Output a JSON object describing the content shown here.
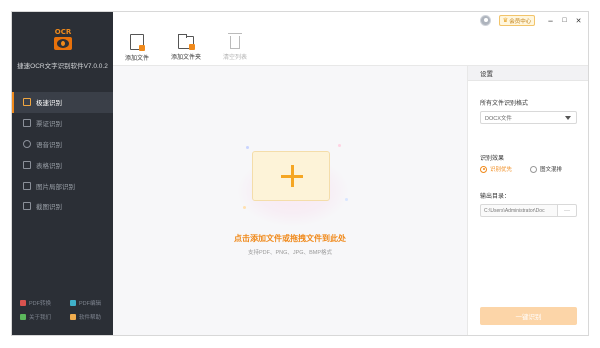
{
  "app": {
    "logo_text": "OCR",
    "title": "捷速OCR文字识别软件V7.0.0.2"
  },
  "sidebar": {
    "items": [
      {
        "label": "极速识别",
        "icon": "lightning-icon",
        "active": true
      },
      {
        "label": "票证识别",
        "icon": "ticket-icon",
        "active": false
      },
      {
        "label": "语音识别",
        "icon": "microphone-icon",
        "active": false
      },
      {
        "label": "表格识别",
        "icon": "table-icon",
        "active": false
      },
      {
        "label": "图片局部识别",
        "icon": "crop-icon",
        "active": false
      },
      {
        "label": "截图识别",
        "icon": "screenshot-icon",
        "active": false
      }
    ],
    "bottom_links": [
      {
        "label": "PDF转换",
        "color": "#d9534f"
      },
      {
        "label": "PDF编辑",
        "color": "#3fb0c9"
      },
      {
        "label": "关于我们",
        "color": "#5cb85c"
      },
      {
        "label": "软件帮助",
        "color": "#f0ad4e"
      }
    ]
  },
  "titlebar": {
    "vip_label": "会员中心",
    "minimize": "−",
    "maximize": "□",
    "close": "✕"
  },
  "toolbar": {
    "add_file": "添加文件",
    "add_folder": "添加文件夹",
    "clear_list": "清空列表"
  },
  "dropzone": {
    "main_text": "点击添加文件或拖拽文件到此处",
    "sub_text": "支持PDF、PNG、JPG、BMP格式"
  },
  "settings": {
    "header": "设置",
    "format_label": "所有文件识别格式",
    "format_value": "DOCX文件",
    "effect_label": "识别效果",
    "effect_options": [
      {
        "label": "识别优先",
        "checked": true
      },
      {
        "label": "图文混排",
        "checked": false
      }
    ],
    "output_label": "输出目录：",
    "output_path": "C:\\Users\\Administrator\\Doc",
    "browse": "···",
    "start_button": "一键识别"
  },
  "colors": {
    "accent": "#f08a1c",
    "sidebar_bg": "#2b2f36",
    "start_button": "#fcd5a8"
  }
}
